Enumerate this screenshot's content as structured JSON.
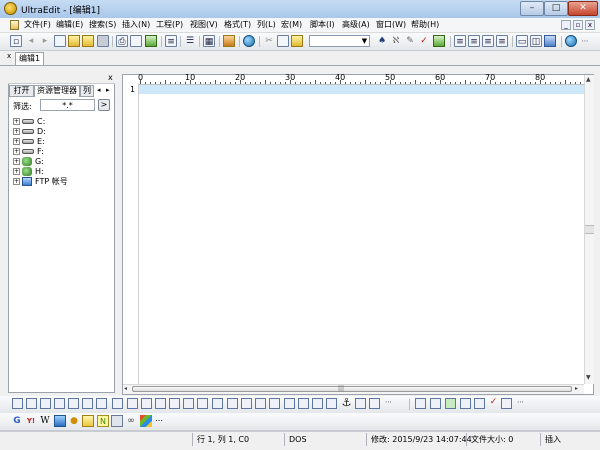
{
  "window": {
    "title": "UltraEdit - [编辑1]",
    "min": "–",
    "max": "□",
    "close": "✕"
  },
  "menu": {
    "items": [
      "文件(F)",
      "编辑(E)",
      "搜索(S)",
      "插入(N)",
      "工程(P)",
      "视图(V)",
      "格式(T)",
      "列(L)",
      "宏(M)",
      "脚本(I)",
      "高级(A)",
      "窗口(W)",
      "帮助(H)"
    ],
    "mdi_min": "_",
    "mdi_restore": "▫",
    "mdi_close": "x"
  },
  "toolbar": {
    "icons": [
      "new-file-icon",
      "open-folder-icon",
      "open-recent-icon",
      "save-icon",
      "print-icon",
      "print-preview-icon",
      "print-setup-icon",
      "page-icon",
      "column-mode-icon",
      "hex-mode-icon",
      "browser-icon",
      "cut-icon",
      "copy-icon",
      "paste-icon",
      "find-icon",
      "replace-icon",
      "find-in-files-icon",
      "spell-icon",
      "print2-icon",
      "align-left-icon",
      "align-center-icon",
      "align-right-icon",
      "justify-icon",
      "split-h-icon",
      "split-v-icon",
      "cascade-icon",
      "globe-icon"
    ],
    "combo_value": ""
  },
  "doc_tabs": {
    "close_glyph": "x",
    "active": "编辑1"
  },
  "left_panel": {
    "close_glyph": "x",
    "tabs": [
      "打开",
      "资源管理器",
      "列"
    ],
    "nav_prev": "◂",
    "nav_next": "▸",
    "filter_label": "筛选:",
    "filter_value": "*.*",
    "filter_go": ">",
    "tree": [
      {
        "label": "C:",
        "type": "drive"
      },
      {
        "label": "D:",
        "type": "drive"
      },
      {
        "label": "E:",
        "type": "drive"
      },
      {
        "label": "F:",
        "type": "drive"
      },
      {
        "label": "G:",
        "type": "network"
      },
      {
        "label": "H:",
        "type": "network"
      },
      {
        "label": "FTP 帐号",
        "type": "ftp"
      }
    ],
    "expand_glyph": "+"
  },
  "editor": {
    "ruler_labels": [
      "0",
      "10",
      "20",
      "30",
      "40",
      "50",
      "60",
      "70",
      "80"
    ],
    "line_number": "1",
    "hscroll_grip": "|||",
    "up": "▲",
    "down": "▼",
    "left": "◂",
    "right": "▸"
  },
  "format_toolbar": {
    "icons": [
      "bold-icon",
      "italic-icon",
      "underline-icon",
      "strike-icon",
      "bullets-icon",
      "numbering-icon",
      "font-icon",
      "color-icon",
      "align-icon",
      "indent-icon",
      "outdent-icon",
      "table-icon",
      "image-icon",
      "link-icon",
      "anchor-icon",
      "form-icon",
      "hr-icon",
      "checkbox-icon",
      "radio-icon",
      "select-icon",
      "input-icon",
      "frame-icon",
      "layer-icon",
      "more-icon"
    ],
    "more_glyph": "⋯"
  },
  "web_toolbar": {
    "icons": [
      "google-icon",
      "yahoo-icon",
      "wikipedia-icon",
      "msn-icon",
      "bulb-icon",
      "note-icon",
      "notepad-icon",
      "calc-icon",
      "link2-icon",
      "windows-icon"
    ],
    "letters": [
      "G",
      "Y!",
      "W",
      "",
      "",
      "",
      "N",
      "",
      "",
      ""
    ],
    "more_glyph": "⋯"
  },
  "status": {
    "position": "行 1, 列 1, C0",
    "line_ending": "DOS",
    "modified": "修改: 2015/9/23 14:07:44",
    "file_size": "文件大小: 0",
    "insert_mode": "插入"
  }
}
